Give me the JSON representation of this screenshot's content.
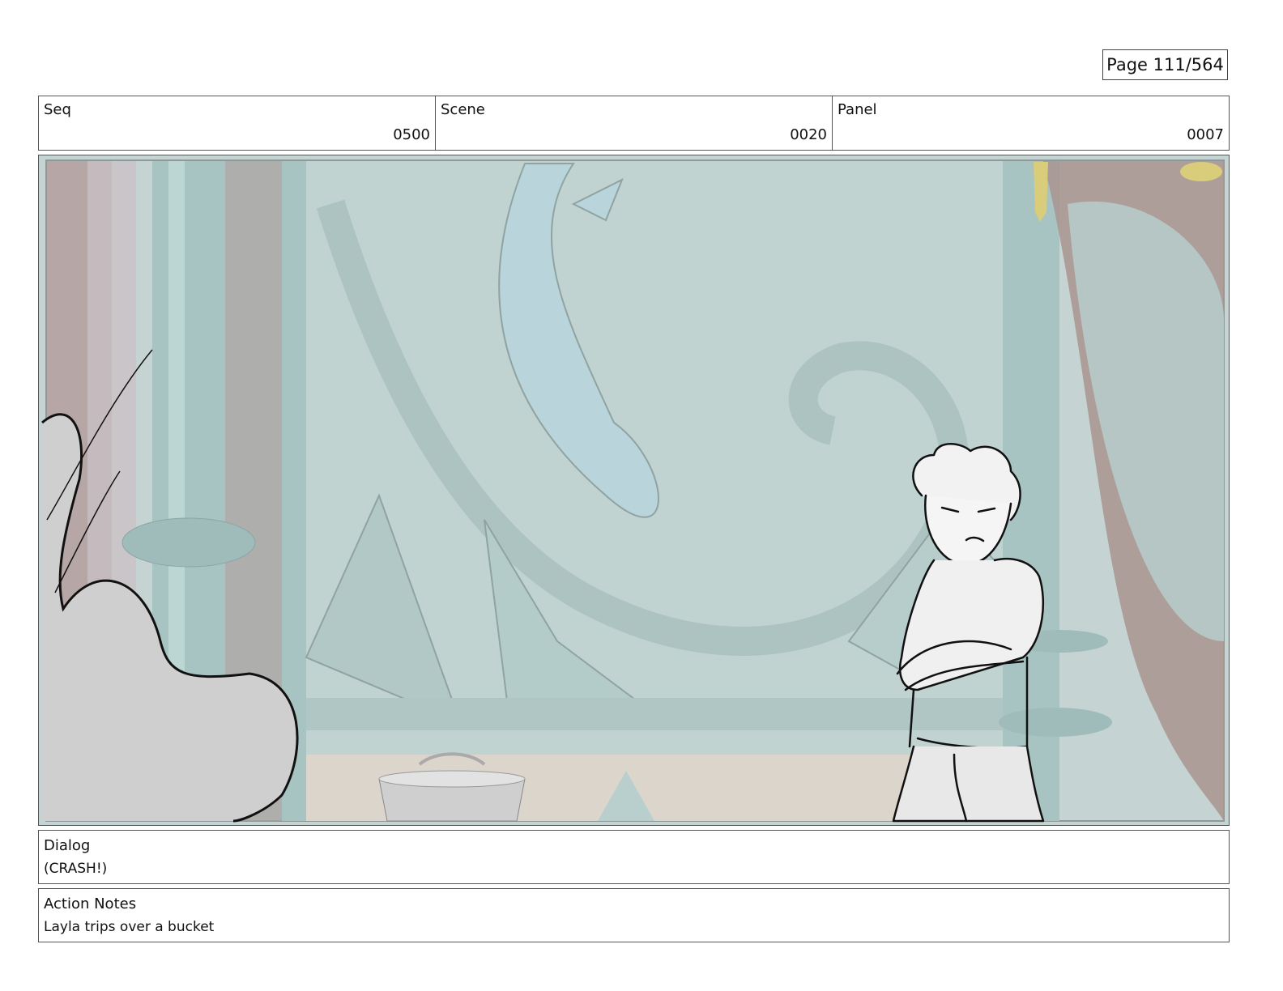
{
  "page": {
    "label": "Page 111/564"
  },
  "header": {
    "seq": {
      "label": "Seq",
      "value": "0500"
    },
    "scene": {
      "label": "Scene",
      "value": "0020"
    },
    "panel": {
      "label": "Panel",
      "value": "0007"
    }
  },
  "frame": {
    "icon": "storyboard-panel-drawing",
    "colors": {
      "wall": "#c1d2d0",
      "pillar": "#a9c6c5",
      "curtain": "#a68f8c",
      "floor": "#ddd6cd",
      "sketch": "#111111"
    }
  },
  "dialog": {
    "label": "Dialog",
    "text": "(CRASH!)"
  },
  "action_notes": {
    "label": "Action Notes",
    "text": "Layla trips over a bucket"
  }
}
